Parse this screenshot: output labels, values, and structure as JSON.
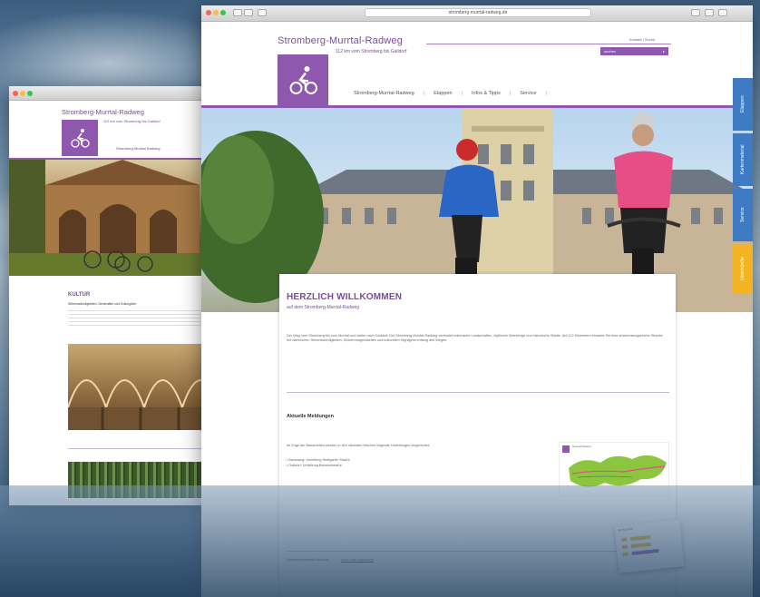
{
  "back_window": {
    "site_title": "Stromberg-Murrtal-Radweg",
    "subtitle": "112 km vom Stromberg bis Gaildorf",
    "nav_item": "Stromberg-Murrtal-Radweg",
    "section_heading": "KULTUR",
    "section_sub": "Sehenswürdigkeiten, Denkmäler und Kulturgüter"
  },
  "front_window": {
    "url": "stromberg-murrtal-radweg.de",
    "site_title": "Stromberg-Murrtal-Radweg",
    "subtitle": "112 km vom Stromberg bis Gaildorf",
    "top_links": "Kontakt | Suche",
    "search_placeholder": "suchen",
    "nav": [
      "Stromberg-Murrtal-Radweg",
      "Etappen",
      "Infos & Tipps",
      "Service"
    ],
    "welcome_title": "HERZLICH WILLKOMMEN",
    "welcome_sub": "auf dem Stromberg-Murrtal-Radweg",
    "body_text": "Der Weg vom Stromberg bis zum Murrtal und weiter nach Gaildorf: Der Stromberg-Murrtal-Radweg verbindet malerische Landschaften, idyllische Weinberge und historische Städte. Auf 112 Kilometern erwartet Sie eine abwechslungsreiche Strecke mit zahlreichen Sehenswürdigkeiten, Einkehrmöglichkeiten und kulturellen Highlights entlang des Weges.",
    "news_heading": "Aktuelle Meldungen",
    "news_text": "Im Zuge der Bauarbeiten werden in den nächsten Wochen folgende Umleitungen eingerichtet:",
    "news_items": [
      "• Backnang: Umleitung Stuttgarter Straße",
      "• Gaildorf: Umleitung Bahnhofstraße"
    ],
    "map_label": "Übersichtskarte",
    "flyer_label": "Broschüre",
    "footer_text": "Stromberg-Murrtal-Radweg",
    "footer_link": "Links und Impressum",
    "side_tabs": [
      {
        "label": "Etappen",
        "color": "#3e7bc2"
      },
      {
        "label": "Kartenmaterial",
        "color": "#3e7bc2"
      },
      {
        "label": "Service",
        "color": "#3e7bc2"
      },
      {
        "label": "Unterkünfte",
        "color": "#f3b421"
      }
    ]
  },
  "colors": {
    "accent": "#8d58ad",
    "tab_blue": "#3e7bc2",
    "tab_yellow": "#f3b421"
  }
}
